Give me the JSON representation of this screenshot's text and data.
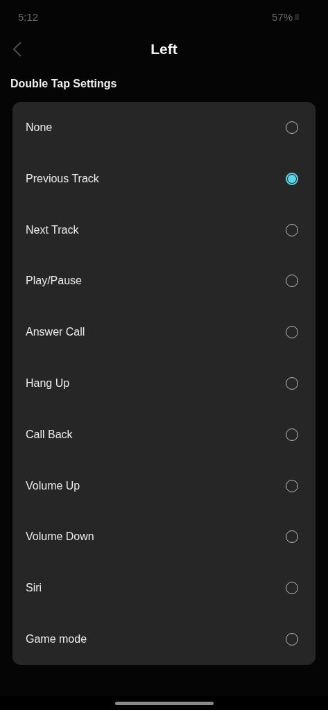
{
  "status_bar": {
    "time": "5:12",
    "battery": "57%"
  },
  "header": {
    "title": "Left"
  },
  "section": {
    "title": "Double Tap Settings"
  },
  "options": [
    {
      "label": "None",
      "selected": false
    },
    {
      "label": "Previous Track",
      "selected": true
    },
    {
      "label": "Next Track",
      "selected": false
    },
    {
      "label": "Play/Pause",
      "selected": false
    },
    {
      "label": "Answer Call",
      "selected": false
    },
    {
      "label": "Hang Up",
      "selected": false
    },
    {
      "label": "Call Back",
      "selected": false
    },
    {
      "label": "Volume Up",
      "selected": false
    },
    {
      "label": "Volume Down",
      "selected": false
    },
    {
      "label": "Siri",
      "selected": false
    },
    {
      "label": "Game mode",
      "selected": false
    }
  ]
}
